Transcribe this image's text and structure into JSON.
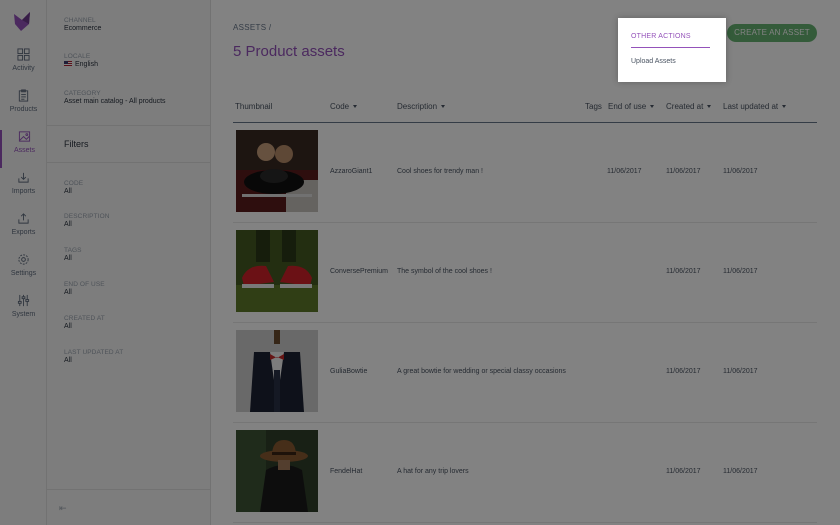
{
  "nav": {
    "items": [
      {
        "label": "Activity",
        "icon": "dashboard-icon"
      },
      {
        "label": "Products",
        "icon": "clipboard-icon"
      },
      {
        "label": "Assets",
        "icon": "image-icon"
      },
      {
        "label": "Imports",
        "icon": "import-icon"
      },
      {
        "label": "Exports",
        "icon": "export-icon"
      },
      {
        "label": "Settings",
        "icon": "gear-icon"
      },
      {
        "label": "System",
        "icon": "sliders-icon"
      }
    ],
    "active": "Assets"
  },
  "context": {
    "channel_label": "CHANNEL",
    "channel_value": "Ecommerce",
    "locale_label": "LOCALE",
    "locale_value": "English",
    "category_label": "CATEGORY",
    "category_value": "Asset main catalog - All products"
  },
  "filters": {
    "title": "Filters",
    "add_icon": "+",
    "items": [
      {
        "label": "CODE",
        "value": "All"
      },
      {
        "label": "DESCRIPTION",
        "value": "All"
      },
      {
        "label": "TAGS",
        "value": "All"
      },
      {
        "label": "END OF USE",
        "value": "All"
      },
      {
        "label": "CREATED AT",
        "value": "All"
      },
      {
        "label": "LAST UPDATED AT",
        "value": "All"
      }
    ]
  },
  "header": {
    "breadcrumb": "ASSETS /",
    "title": "5 Product assets",
    "create_button": "CREATE AN ASSET"
  },
  "menu": {
    "title": "OTHER ACTIONS",
    "items": [
      "Upload Assets"
    ]
  },
  "table": {
    "columns": [
      "Thumbnail",
      "Code",
      "Description",
      "Tags",
      "End of use",
      "Created at",
      "Last updated at"
    ],
    "rows": [
      {
        "code": "AzzaroGiant1",
        "description": "Cool shoes for trendy man !",
        "tags": "",
        "end_of_use": "11/06/2017",
        "created_at": "11/06/2017",
        "updated_at": "11/06/2017"
      },
      {
        "code": "ConversePremium",
        "description": "The symbol of the cool shoes !",
        "tags": "",
        "end_of_use": "",
        "created_at": "11/06/2017",
        "updated_at": "11/06/2017"
      },
      {
        "code": "GuliaBowtie",
        "description": "A great bowtie for wedding or special classy occasions",
        "tags": "",
        "end_of_use": "",
        "created_at": "11/06/2017",
        "updated_at": "11/06/2017"
      },
      {
        "code": "FendelHat",
        "description": "A hat for any trip lovers",
        "tags": "",
        "end_of_use": "",
        "created_at": "11/06/2017",
        "updated_at": "11/06/2017"
      }
    ]
  },
  "colors": {
    "accent": "#9452ba",
    "create_button": "#67b373",
    "overlay": "rgba(0,0,0,0.49)"
  }
}
